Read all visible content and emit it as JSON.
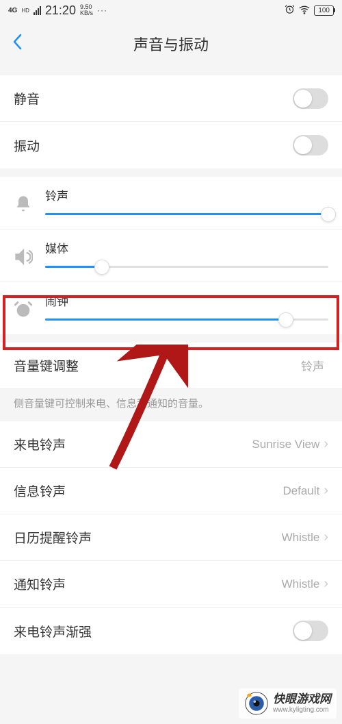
{
  "status_bar": {
    "network": "4G",
    "hd": "HD",
    "time": "21:20",
    "speed_top": "9.50",
    "speed_bot": "KB/s",
    "dots": "···",
    "battery": "100"
  },
  "header": {
    "title": "声音与振动"
  },
  "toggles": {
    "silent": "静音",
    "vibrate": "振动"
  },
  "sliders": {
    "ringtone": {
      "label": "铃声",
      "percent": 100
    },
    "media": {
      "label": "媒体",
      "percent": 20
    },
    "alarm": {
      "label": "闹钟",
      "percent": 85
    }
  },
  "volume_key": {
    "label": "音量键调整",
    "value": "铃声",
    "desc": "侧音量键可控制来电、信息和通知的音量。"
  },
  "ringtones": {
    "incoming": {
      "label": "来电铃声",
      "value": "Sunrise View"
    },
    "message": {
      "label": "信息铃声",
      "value": "Default"
    },
    "calendar": {
      "label": "日历提醒铃声",
      "value": "Whistle"
    },
    "notification": {
      "label": "通知铃声",
      "value": "Whistle"
    },
    "ascending": {
      "label": "来电铃声渐强"
    }
  },
  "watermark": {
    "title": "快眼游戏网",
    "url": "www.kyligting.com"
  }
}
